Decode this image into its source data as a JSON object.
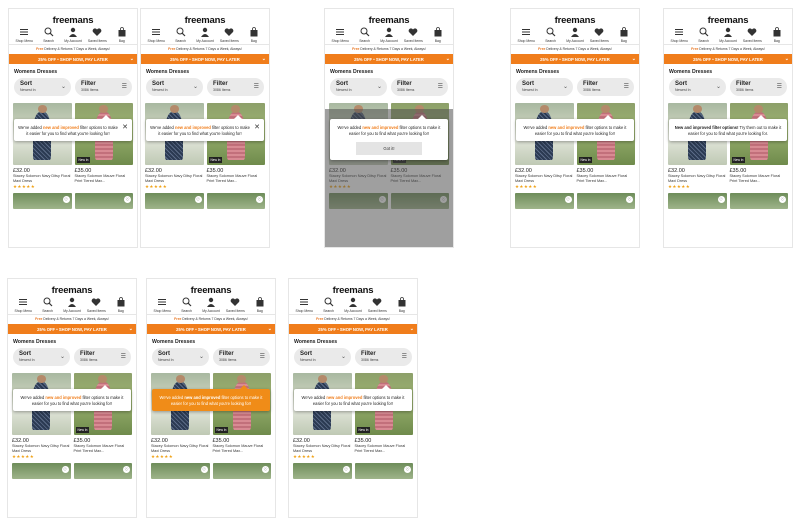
{
  "screens": [
    {
      "tip": {
        "pre": "We've added ",
        "bold": "new and improved",
        "post": " filter options to make it easier for you to find what you're looking for!",
        "close": "✕",
        "button": ""
      }
    },
    {
      "tip": {
        "pre": "We've added ",
        "bold": "new and improved",
        "post": " filter options to make it easier for you to find what you're looking for!",
        "close": "✕",
        "button": ""
      }
    },
    {
      "tip": {
        "pre": "We've added ",
        "bold": "new and improved",
        "post": " filter options to make it easier for you to find what you're looking for!",
        "close": "",
        "button": "Got it!"
      }
    },
    {
      "tip": {
        "pre": "We've added ",
        "bold": "new and improved",
        "post": " filter options to make it easier for you to find what you're looking for!",
        "close": "",
        "button": ""
      }
    },
    {
      "tip": {
        "pre": "",
        "bold": "New and improved filter options!",
        "post": " Try them out to make it easier for you to find what you're looking for.",
        "close": "",
        "button": ""
      }
    },
    {
      "tip": {
        "pre": "We've added ",
        "bold": "new and improved",
        "post": " filter options to make it easier for you to find what you're looking for!",
        "close": "",
        "button": ""
      }
    },
    {
      "tip": {
        "pre": "We've added ",
        "bold": "new and improved",
        "post": " filter options to make it easier for you to find what you're looking for!",
        "close": "",
        "button": ""
      }
    },
    {
      "tip": {
        "pre": "We've added ",
        "bold": "new and improved",
        "post": " filter options to make it easier for you to find what you're looking for!",
        "close": "",
        "button": ""
      }
    }
  ],
  "header": {
    "logo": "freemans",
    "nav": [
      "Shop Menu",
      "Search",
      "My Account",
      "Saved Items",
      "Bag"
    ],
    "delivery_bold": "Free",
    "delivery_rest": " Delivery & Returns 7 Days a Week, Always!"
  },
  "promo": "25% OFF • SHOP NOW, PAY LATER",
  "page_title": "Womens Dresses",
  "sort": {
    "label": "Sort",
    "sub": "Newest In"
  },
  "filter": {
    "label": "Filter",
    "sub": "3086 Items"
  },
  "products": [
    {
      "price": "£32.00",
      "name": "Stacey Solomon Navy Ditsy Floral Maxi Dress",
      "rating": "★★★★★",
      "badge": ""
    },
    {
      "price": "£35.00",
      "name": "Stacey Solomon Mauve Floral Print Tiered Max...",
      "rating": "",
      "badge": "New In"
    }
  ],
  "colors": {
    "accent": "#f07d1b",
    "promo": "#f07d1b",
    "stars": "#f0a318"
  }
}
